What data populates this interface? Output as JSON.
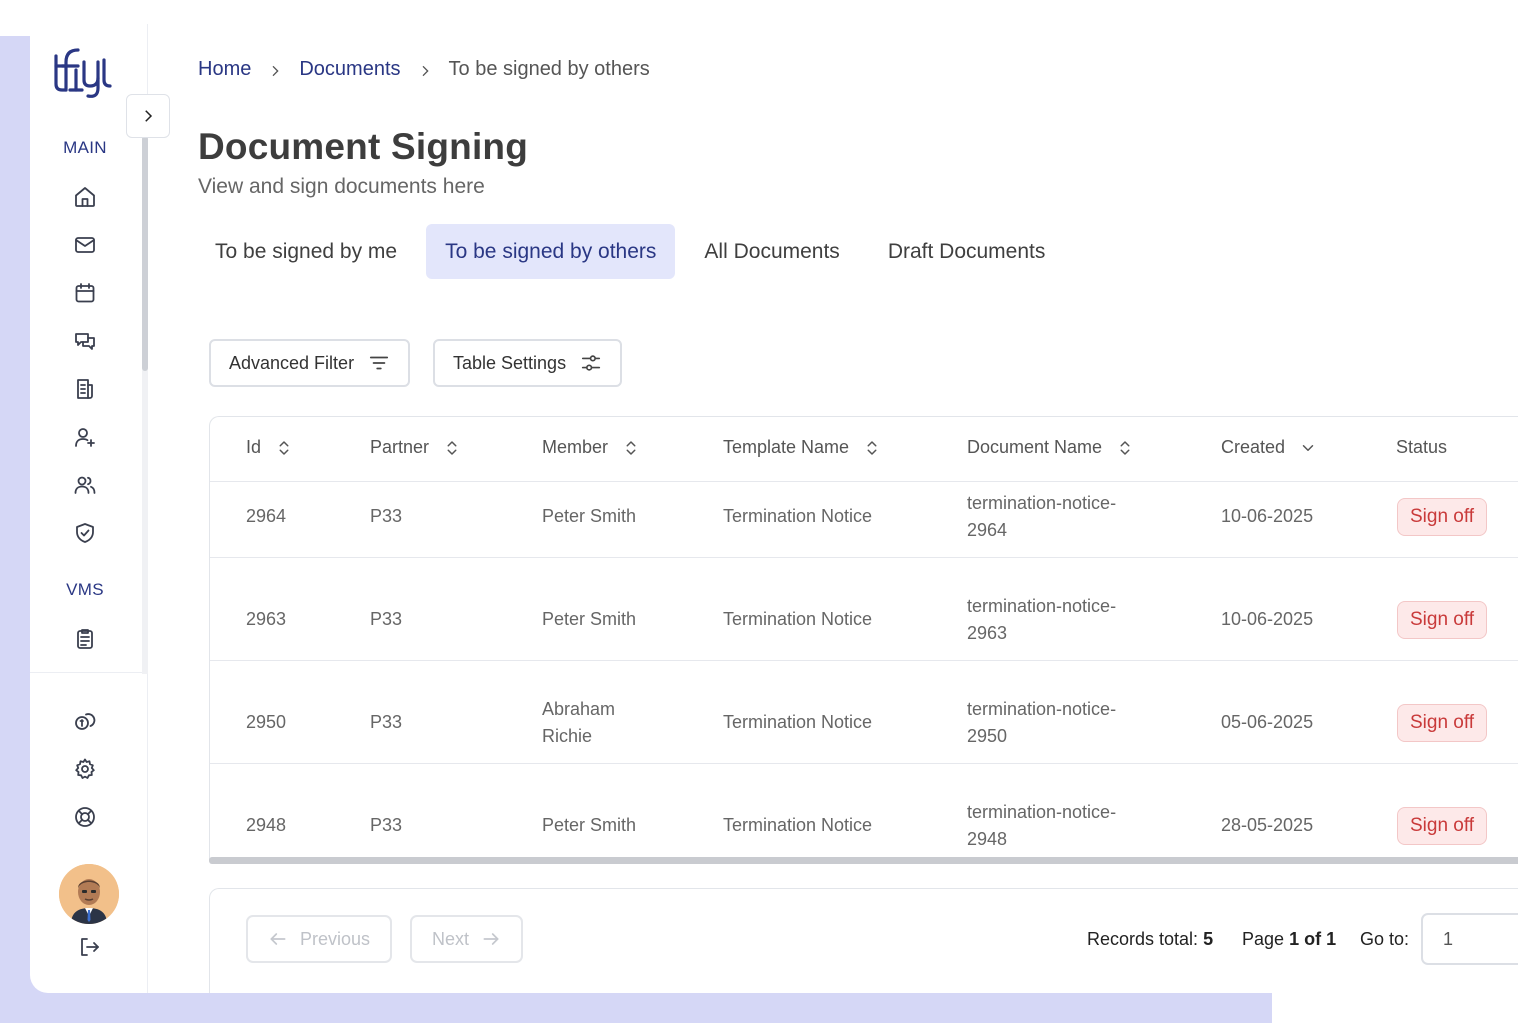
{
  "sidebar": {
    "logo_text": "tfy",
    "section_main": "MAIN",
    "section_vms": "VMS",
    "icons_main": [
      "home-icon",
      "mail-icon",
      "calendar-icon",
      "chat-icon",
      "document-icon",
      "add-user-icon",
      "users-icon",
      "shield-check-icon"
    ],
    "icons_vms": [
      "clipboard-icon"
    ],
    "icons_bottom": [
      "coins-icon",
      "gear-icon",
      "lifebuoy-icon"
    ],
    "logout_icon": "logout-icon"
  },
  "breadcrumb": {
    "home": "Home",
    "documents": "Documents",
    "current": "To be signed by others"
  },
  "header": {
    "title": "Document Signing",
    "subtitle": "View and sign documents here"
  },
  "tabs": [
    {
      "label": "To be signed by me",
      "active": false
    },
    {
      "label": "To be signed by others",
      "active": true
    },
    {
      "label": "All Documents",
      "active": false
    },
    {
      "label": "Draft Documents",
      "active": false
    }
  ],
  "toolbar": {
    "advanced_filter": "Advanced Filter",
    "table_settings": "Table Settings"
  },
  "table": {
    "columns": [
      "Id",
      "Partner",
      "Member",
      "Template Name",
      "Document Name",
      "Created",
      "Status"
    ],
    "rows": [
      {
        "id": "2964",
        "partner": "P33",
        "member_1": "Peter Smith",
        "member_2": "",
        "template": "Termination Notice",
        "doc_1": "termination-notice-",
        "doc_2": "2964",
        "created": "10-06-2025",
        "status": "Sign off"
      },
      {
        "id": "2963",
        "partner": "P33",
        "member_1": "Peter Smith",
        "member_2": "",
        "template": "Termination Notice",
        "doc_1": "termination-notice-",
        "doc_2": "2963",
        "created": "10-06-2025",
        "status": "Sign off"
      },
      {
        "id": "2950",
        "partner": "P33",
        "member_1": "Abraham",
        "member_2": "Richie",
        "template": "Termination Notice",
        "doc_1": "termination-notice-",
        "doc_2": "2950",
        "created": "05-06-2025",
        "status": "Sign off"
      },
      {
        "id": "2948",
        "partner": "P33",
        "member_1": "Peter Smith",
        "member_2": "",
        "template": "Termination Notice",
        "doc_1": "termination-notice-",
        "doc_2": "2948",
        "created": "28-05-2025",
        "status": "Sign off"
      }
    ]
  },
  "pagination": {
    "previous": "Previous",
    "next": "Next",
    "records_label": "Records total:",
    "records_total": "5",
    "page_label": "Page",
    "page_value": "1 of 1",
    "goto_label": "Go to:",
    "goto_value": "1"
  },
  "colors": {
    "accent": "#2a3784",
    "active_tab_bg": "#e3e6fb",
    "status_text": "#c93a3a",
    "status_bg": "#fde9e9",
    "frame_bg": "#d5d7f6"
  }
}
